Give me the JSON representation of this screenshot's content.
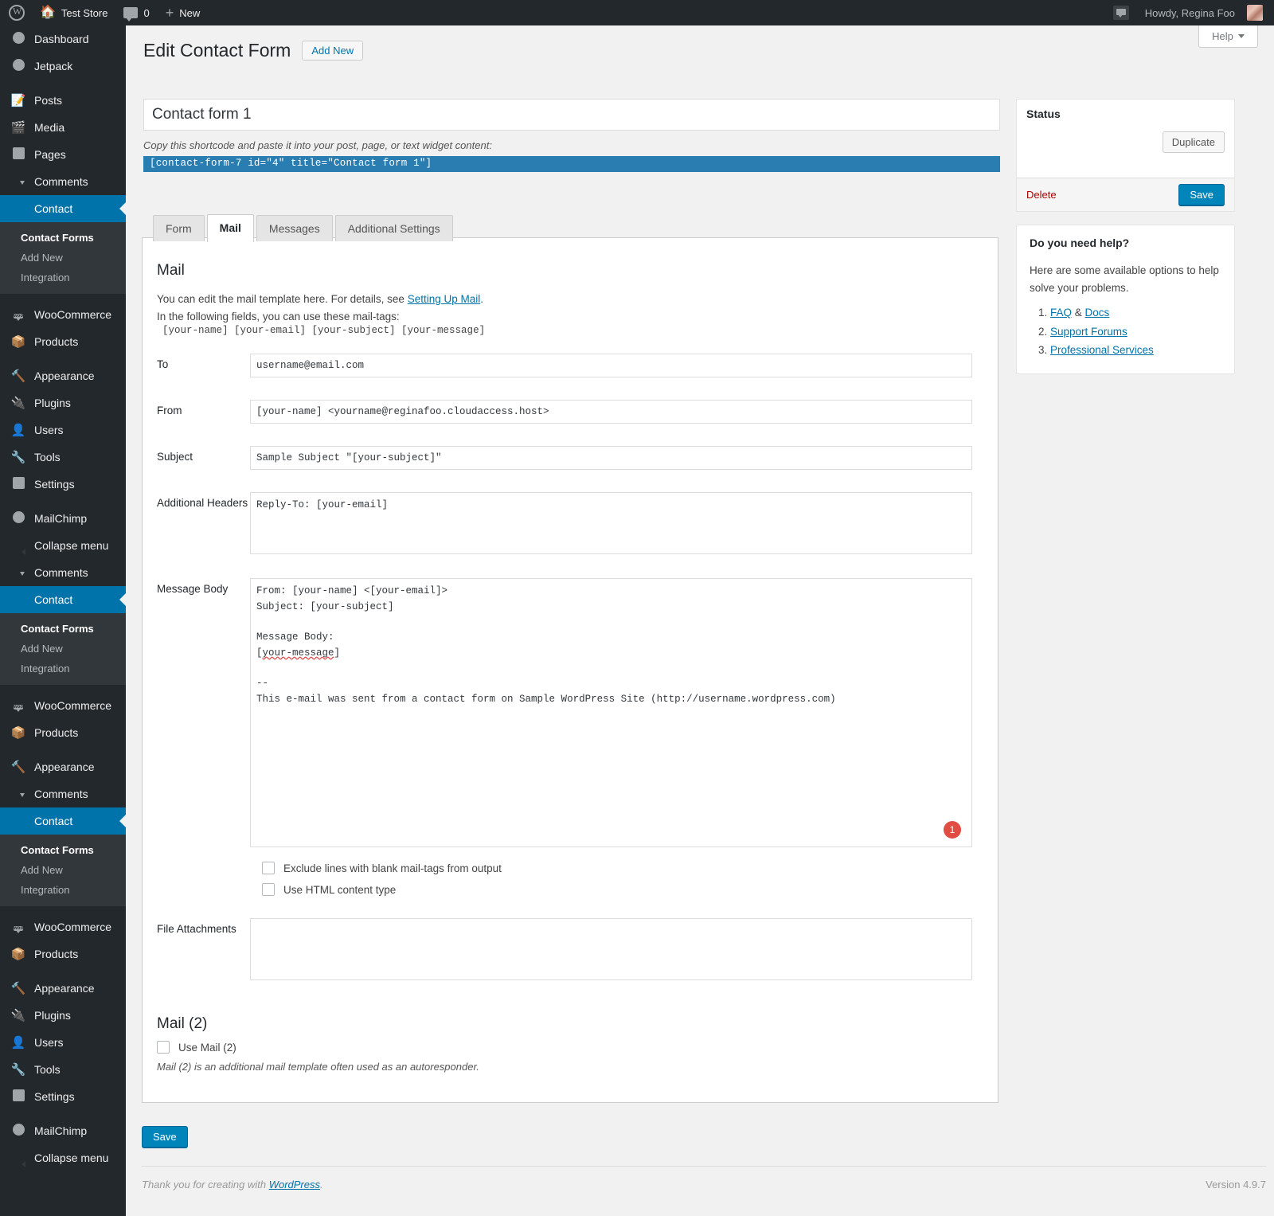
{
  "adminbar": {
    "site_name": "Test Store",
    "comment_count": "0",
    "new_label": "New",
    "howdy": "Howdy, Regina Foo",
    "icons": {
      "wordpress": "wordpress-logo-icon",
      "home": "home-icon",
      "comments": "comment-bubble-icon",
      "new": "plus-icon",
      "avatar": "user-avatar"
    }
  },
  "sidebar": {
    "blocks": [
      {
        "items": [
          {
            "label": "Dashboard",
            "icon": "dashboard-icon",
            "current": false
          },
          {
            "label": "Jetpack",
            "icon": "jetpack-icon",
            "current": false
          }
        ]
      },
      {
        "items": [
          {
            "label": "Posts",
            "icon": "posts-icon",
            "current": false
          },
          {
            "label": "Media",
            "icon": "media-icon",
            "current": false
          },
          {
            "label": "Pages",
            "icon": "pages-icon",
            "current": false
          },
          {
            "label": "Comments",
            "icon": "comments-icon",
            "current": false
          },
          {
            "label": "Contact",
            "icon": "mail-envelope-icon",
            "current": true
          }
        ],
        "submenu": [
          "Contact Forms",
          "Add New",
          "Integration"
        ],
        "submenu_current": "Contact Forms"
      },
      {
        "items": [
          {
            "label": "WooCommerce",
            "icon": "woocommerce-icon",
            "current": false
          },
          {
            "label": "Products",
            "icon": "products-box-icon",
            "current": false
          }
        ]
      },
      {
        "items": [
          {
            "label": "Appearance",
            "icon": "appearance-brush-icon",
            "current": false
          },
          {
            "label": "Plugins",
            "icon": "plugins-plug-icon",
            "current": false
          },
          {
            "label": "Users",
            "icon": "users-icon",
            "current": false
          },
          {
            "label": "Tools",
            "icon": "tools-wrench-icon",
            "current": false
          },
          {
            "label": "Settings",
            "icon": "settings-sliders-icon",
            "current": false
          }
        ]
      },
      {
        "items": [
          {
            "label": "MailChimp",
            "icon": "mailchimp-icon",
            "current": false
          },
          {
            "label": "Collapse menu",
            "icon": "collapse-arrow-icon",
            "current": false
          },
          {
            "label": "Comments",
            "icon": "comments-icon",
            "current": false
          },
          {
            "label": "Contact",
            "icon": "mail-envelope-icon",
            "current": true
          }
        ],
        "submenu": [
          "Contact Forms",
          "Add New",
          "Integration"
        ],
        "submenu_current": "Contact Forms"
      },
      {
        "items": [
          {
            "label": "WooCommerce",
            "icon": "woocommerce-icon",
            "current": false
          },
          {
            "label": "Products",
            "icon": "products-box-icon",
            "current": false
          }
        ]
      },
      {
        "items": [
          {
            "label": "Appearance",
            "icon": "appearance-brush-icon",
            "current": false
          },
          {
            "label": "Comments",
            "icon": "comments-icon",
            "current": false
          },
          {
            "label": "Contact",
            "icon": "mail-envelope-icon",
            "current": true
          }
        ],
        "submenu": [
          "Contact Forms",
          "Add New",
          "Integration"
        ],
        "submenu_current": "Contact Forms"
      },
      {
        "items": [
          {
            "label": "WooCommerce",
            "icon": "woocommerce-icon",
            "current": false
          },
          {
            "label": "Products",
            "icon": "products-box-icon",
            "current": false
          }
        ]
      },
      {
        "items": [
          {
            "label": "Appearance",
            "icon": "appearance-brush-icon",
            "current": false
          },
          {
            "label": "Plugins",
            "icon": "plugins-plug-icon",
            "current": false
          },
          {
            "label": "Users",
            "icon": "users-icon",
            "current": false
          },
          {
            "label": "Tools",
            "icon": "tools-wrench-icon",
            "current": false
          },
          {
            "label": "Settings",
            "icon": "settings-sliders-icon",
            "current": false
          }
        ]
      },
      {
        "items": [
          {
            "label": "MailChimp",
            "icon": "mailchimp-icon",
            "current": false
          },
          {
            "label": "Collapse menu",
            "icon": "collapse-arrow-icon",
            "current": false
          }
        ]
      }
    ]
  },
  "header": {
    "help_label": "Help",
    "page_title": "Edit Contact Form",
    "add_new_label": "Add New"
  },
  "form": {
    "title_value": "Contact form 1",
    "shortcode_hint": "Copy this shortcode and paste it into your post, page, or text widget content:",
    "shortcode_value": "[contact-form-7 id=\"4\" title=\"Contact form 1\"]",
    "tabs": [
      {
        "label": "Form",
        "active": false
      },
      {
        "label": "Mail",
        "active": true
      },
      {
        "label": "Messages",
        "active": false
      },
      {
        "label": "Additional Settings",
        "active": false
      }
    ]
  },
  "mail": {
    "heading": "Mail",
    "intro_before_link": "You can edit the mail template here. For details, see ",
    "intro_link": "Setting Up Mail",
    "intro_after_link": ".",
    "intro_line2": "In the following fields, you can use these mail-tags:",
    "mail_tags": "[your-name]  [your-email]  [your-subject]  [your-message]",
    "fields": {
      "to_label": "To",
      "to_value": "username@email.com",
      "from_label": "From",
      "from_value": "[your-name] <yourname@reginafoo.cloudaccess.host>",
      "subject_label": "Subject",
      "subject_value": "Sample Subject \"[your-subject]\"",
      "headers_label": "Additional Headers",
      "headers_value": "Reply-To: [your-email]",
      "body_label": "Message Body",
      "body_line1": "From: [your-name] <[your-email]>",
      "body_line2": "Subject: [your-subject]",
      "body_line4": "Message Body:",
      "body_tag": "your-message",
      "body_line7": "--",
      "body_line8": "This e-mail was sent from a contact form on Sample WordPress Site (http://username.wordpress.com)",
      "attachments_label": "File Attachments",
      "attachments_value": ""
    },
    "badge_count": "1",
    "checkboxes": [
      {
        "label": "Exclude lines with blank mail-tags from output",
        "checked": false
      },
      {
        "label": "Use HTML content type",
        "checked": false
      }
    ],
    "mail2_heading": "Mail (2)",
    "mail2_checkbox": "Use Mail (2)",
    "mail2_note": "Mail (2) is an additional mail template often used as an autoresponder.",
    "save_label": "Save"
  },
  "status_box": {
    "title": "Status",
    "duplicate_label": "Duplicate",
    "delete_label": "Delete",
    "save_label": "Save"
  },
  "help_box": {
    "title": "Do you need help?",
    "text": "Here are some available options to help solve your problems.",
    "links": [
      {
        "prefix": "",
        "label": "FAQ",
        "between": " & ",
        "label2": "Docs"
      },
      {
        "prefix": "",
        "label": "Support Forums",
        "between": "",
        "label2": ""
      },
      {
        "prefix": "",
        "label": "Professional Services",
        "between": "",
        "label2": ""
      }
    ]
  },
  "footer": {
    "thanks_before": "Thank you for creating with ",
    "thanks_link": "WordPress",
    "thanks_after": ".",
    "version": "Version 4.9.7"
  },
  "colors": {
    "admin_dark": "#23282d",
    "admin_submenu": "#32373c",
    "accent_blue": "#0073aa",
    "button_blue": "#0085ba",
    "shortcode_blue": "#2a7db1",
    "badge_red": "#e14d43",
    "delete_red": "#a00"
  }
}
